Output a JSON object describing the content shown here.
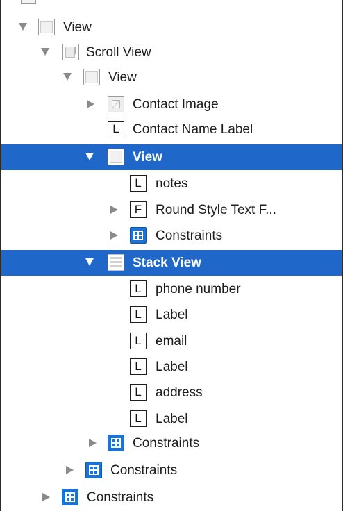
{
  "outline": {
    "nodes": [
      {
        "label": "View"
      },
      {
        "label": "Scroll View"
      },
      {
        "label": "View"
      },
      {
        "label": "Contact Image"
      },
      {
        "label": "Contact Name Label",
        "badge": "L"
      },
      {
        "label": "View"
      },
      {
        "label": "notes",
        "badge": "L"
      },
      {
        "label": "Round Style Text F...",
        "badge": "F"
      },
      {
        "label": "Constraints"
      },
      {
        "label": "Stack View"
      },
      {
        "label": "phone number",
        "badge": "L"
      },
      {
        "label": "Label",
        "badge": "L"
      },
      {
        "label": "email",
        "badge": "L"
      },
      {
        "label": "Label",
        "badge": "L"
      },
      {
        "label": "address",
        "badge": "L"
      },
      {
        "label": "Label",
        "badge": "L"
      },
      {
        "label": "Constraints"
      },
      {
        "label": "Constraints"
      },
      {
        "label": "Constraints"
      }
    ]
  },
  "colors": {
    "selection": "#1f67c9",
    "constraints_icon": "#1a73d6",
    "disclosure": "#8a8a8a"
  }
}
